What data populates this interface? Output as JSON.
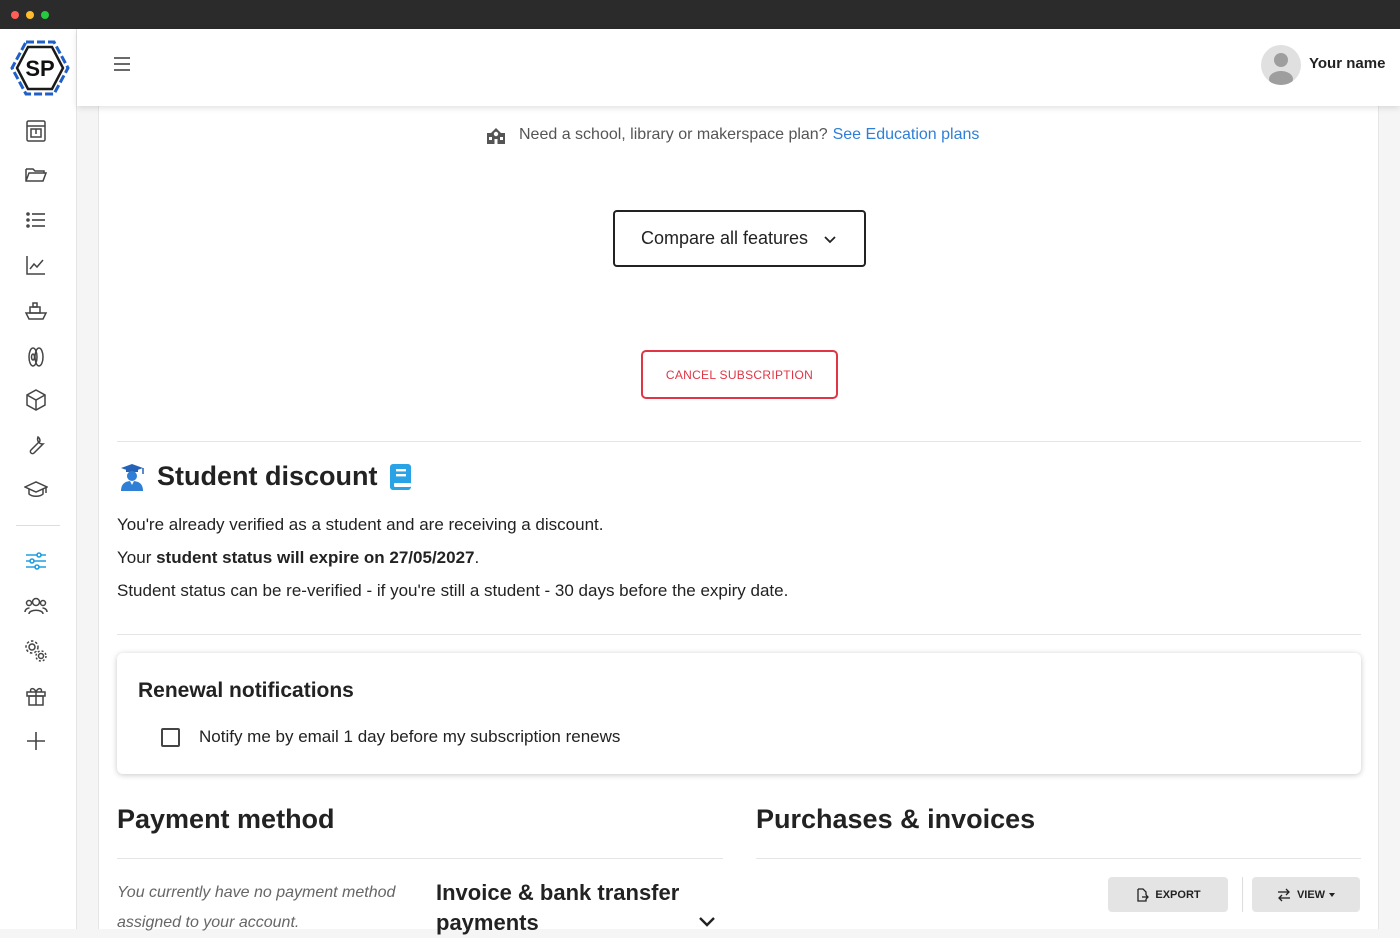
{
  "window": {
    "dots": [
      "red",
      "yellow",
      "green"
    ]
  },
  "sidebar": {
    "logo_text": "SP",
    "items": [
      {
        "name": "printer-icon"
      },
      {
        "name": "folder-icon"
      },
      {
        "name": "list-icon"
      },
      {
        "name": "chart-line-icon"
      },
      {
        "name": "ship-icon"
      },
      {
        "name": "filament-spool-icon"
      },
      {
        "name": "cube-icon"
      },
      {
        "name": "wrench-icon"
      },
      {
        "name": "graduation-cap-icon"
      },
      {
        "name": "sliders-icon",
        "active": true
      },
      {
        "name": "users-icon"
      },
      {
        "name": "gears-icon"
      },
      {
        "name": "gift-icon"
      },
      {
        "name": "plus-icon"
      }
    ],
    "active_color": "#1f9fe0"
  },
  "header": {
    "user_name": "Your name"
  },
  "education": {
    "text": "Need a school, library or makerspace plan?",
    "link": "See Education plans",
    "link_color": "#2f7fd6"
  },
  "compare": {
    "label": "Compare all features"
  },
  "cancel": {
    "label": "CANCEL SUBSCRIPTION",
    "color": "#e03545"
  },
  "student": {
    "title": "Student discount",
    "line1": "You're already verified as a student and are receiving a discount.",
    "line2_prefix": "Your ",
    "line2_bold": "student status will expire on 27/05/2027",
    "line2_suffix": ".",
    "line3": "Student status can be re-verified - if you're still a student - 30 days before the expiry date."
  },
  "renewal": {
    "title": "Renewal notifications",
    "checkbox_label": "Notify me by email 1 day before my subscription renews",
    "checked": false
  },
  "payment": {
    "title": "Payment method",
    "empty_text": "You currently have no payment method assigned to your account.",
    "invoice_title": "Invoice & bank transfer payments"
  },
  "purchases": {
    "title": "Purchases & invoices",
    "export_label": "EXPORT",
    "view_label": "VIEW"
  }
}
